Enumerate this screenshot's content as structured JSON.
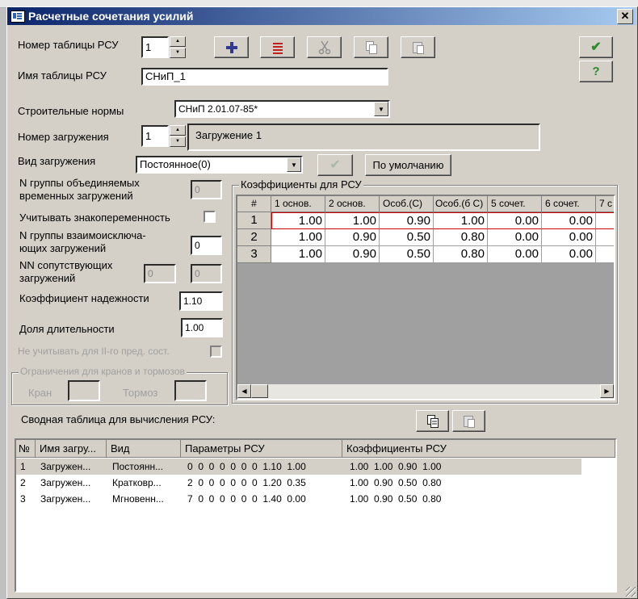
{
  "window": {
    "title": "Расчетные сочетания усилий",
    "close_glyph": "✕"
  },
  "top": {
    "table_number_label": "Номер таблицы РСУ",
    "table_number_value": "1",
    "table_name_label": "Имя таблицы РСУ",
    "table_name_value": "СНиП_1",
    "norms_label": "Строительные нормы",
    "norms_value": "СНиП 2.01.07-85*",
    "load_number_label": "Номер загружения",
    "load_number_value": "1",
    "load_name_value": "Загружение 1",
    "load_type_label": "Вид загружения",
    "load_type_value": "Постоянное(0)",
    "default_button": "По умолчанию"
  },
  "toolbar_icons": [
    "add-icon",
    "delete-icon",
    "cut-icon",
    "copy-icon",
    "paste-icon"
  ],
  "dialog_buttons": {
    "ok_glyph": "✔",
    "help_glyph": "?"
  },
  "colors": {
    "accent_green": "#2e8b2e",
    "title_start": "#0a246a",
    "title_end": "#a6caf0",
    "red_outline": "#d00000"
  },
  "left": {
    "group_temp_label": "N группы объединяемых временных загружений",
    "group_temp_value": "0",
    "sign_variable_label": "Учитывать знакопеременность",
    "group_mutual_label": "N группы взаимоисключа-ющих загружений",
    "group_mutual_value": "0",
    "nn_label": "NN сопутствующих загружений",
    "nn_value1": "0",
    "nn_value2": "0",
    "reliability_label": "Коэффициент надежности",
    "reliability_value": "1.10",
    "duration_label": "Доля длительности",
    "duration_value": "1.00",
    "ignore_label": "Не учитывать для II-го пред. сост.",
    "crane_group_label": "Ограничения для кранов и тормозов",
    "crane_label": "Кран",
    "brake_label": "Тормоз"
  },
  "coef": {
    "group_label": "Коэффициенты для РСУ",
    "headers": [
      "#",
      "1 основ.",
      "2 основ.",
      "Особ.(С)",
      "Особ.(б С)",
      "5 сочет.",
      "6 сочет.",
      "7 с"
    ],
    "rows": [
      {
        "n": "1",
        "values": [
          "1.00",
          "1.00",
          "0.90",
          "1.00",
          "0.00",
          "0.00"
        ]
      },
      {
        "n": "2",
        "values": [
          "1.00",
          "0.90",
          "0.50",
          "0.80",
          "0.00",
          "0.00"
        ]
      },
      {
        "n": "3",
        "values": [
          "1.00",
          "0.90",
          "0.50",
          "0.80",
          "0.00",
          "0.00"
        ]
      }
    ],
    "scroll_left": "◀",
    "scroll_right": "▶"
  },
  "summary": {
    "label": "Сводная таблица для вычисления РСУ:",
    "headers": [
      "№",
      "Имя загру...",
      "Вид",
      "Параметры РСУ",
      "Коэффициенты РСУ"
    ],
    "rows": [
      {
        "n": "1",
        "name": "Загружен...",
        "type": "Постоянн...",
        "params": "0  0  0  0  0  0  0  1.10  1.00",
        "coefs": "1.00  1.00  0.90  1.00"
      },
      {
        "n": "2",
        "name": "Загружен...",
        "type": "Кратковр...",
        "params": "2  0  0  0  0  0  0  1.20  0.35",
        "coefs": "1.00  0.90  0.50  0.80"
      },
      {
        "n": "3",
        "name": "Загружен...",
        "type": "Мгновенн...",
        "params": "7  0  0  0  0  0  0  1.40  0.00",
        "coefs": "1.00  0.90  0.50  0.80"
      }
    ]
  }
}
